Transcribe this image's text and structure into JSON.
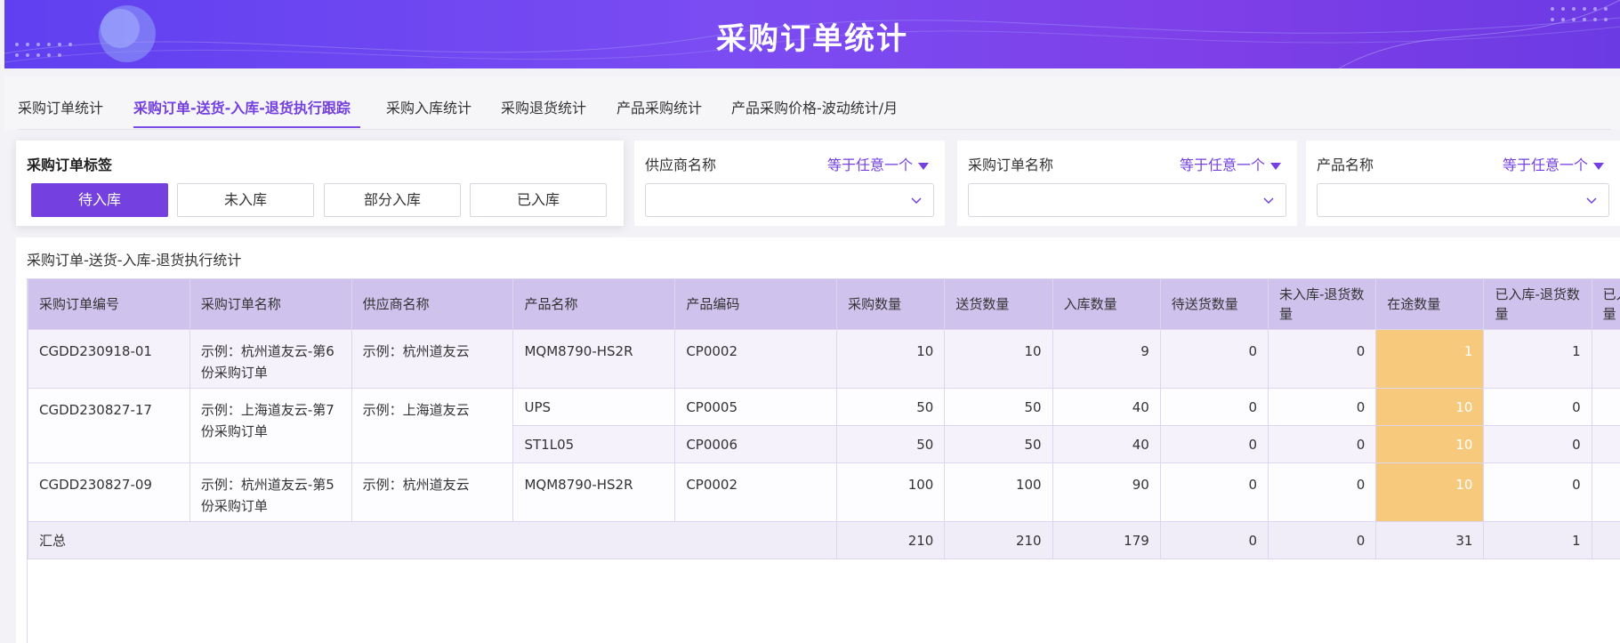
{
  "banner": {
    "title": "采购订单统计"
  },
  "tabs": [
    {
      "label": "采购订单统计"
    },
    {
      "label": "采购订单-送货-入库-退货执行跟踪"
    },
    {
      "label": "采购入库统计"
    },
    {
      "label": "采购退货统计"
    },
    {
      "label": "产品采购统计"
    },
    {
      "label": "产品采购价格-波动统计/月"
    }
  ],
  "tag_filter": {
    "title": "采购订单标签",
    "buttons": [
      "待入库",
      "未入库",
      "部分入库",
      "已入库"
    ]
  },
  "filters": [
    {
      "label": "供应商名称",
      "operator": "等于任意一个"
    },
    {
      "label": "采购订单名称",
      "operator": "等于任意一个"
    },
    {
      "label": "产品名称",
      "operator": "等于任意一个"
    }
  ],
  "table": {
    "title": "采购订单-送货-入库-退货执行统计",
    "headers": [
      "采购订单编号",
      "采购订单名称",
      "供应商名称",
      "产品名称",
      "产品编码",
      "采购数量",
      "送货数量",
      "入库数量",
      "待送货数量",
      "未入库-退货数量",
      "在途数量",
      "已入库-退货数量",
      "已入库-换货数量"
    ],
    "orders": [
      {
        "no": "CGDD230918-01",
        "name": "示例：杭州道友云-第6份采购订单",
        "supplier": "示例：杭州道友云",
        "items": [
          {
            "product": "MQM8790-HS2R",
            "code": "CP0002",
            "qty": "10",
            "delivered": "10",
            "stocked": "9",
            "pending": "0",
            "ret_unstocked": "0",
            "transit": "1",
            "ret_stocked": "1"
          }
        ]
      },
      {
        "no": "CGDD230827-17",
        "name": "示例：上海道友云-第7份采购订单",
        "supplier": "示例：上海道友云",
        "items": [
          {
            "product": "UPS",
            "code": "CP0005",
            "qty": "50",
            "delivered": "50",
            "stocked": "40",
            "pending": "0",
            "ret_unstocked": "0",
            "transit": "10",
            "ret_stocked": "0"
          },
          {
            "product": "ST1L05",
            "code": "CP0006",
            "qty": "50",
            "delivered": "50",
            "stocked": "40",
            "pending": "0",
            "ret_unstocked": "0",
            "transit": "10",
            "ret_stocked": "0"
          }
        ]
      },
      {
        "no": "CGDD230827-09",
        "name": "示例：杭州道友云-第5份采购订单",
        "supplier": "示例：杭州道友云",
        "items": [
          {
            "product": "MQM8790-HS2R",
            "code": "CP0002",
            "qty": "100",
            "delivered": "100",
            "stocked": "90",
            "pending": "0",
            "ret_unstocked": "0",
            "transit": "10",
            "ret_stocked": "0"
          }
        ]
      }
    ],
    "summary": {
      "label": "汇总",
      "qty": "210",
      "delivered": "210",
      "stocked": "179",
      "pending": "0",
      "ret_unstocked": "0",
      "transit": "31",
      "ret_stocked": "1"
    },
    "highlight_color": "#f7c97d"
  }
}
